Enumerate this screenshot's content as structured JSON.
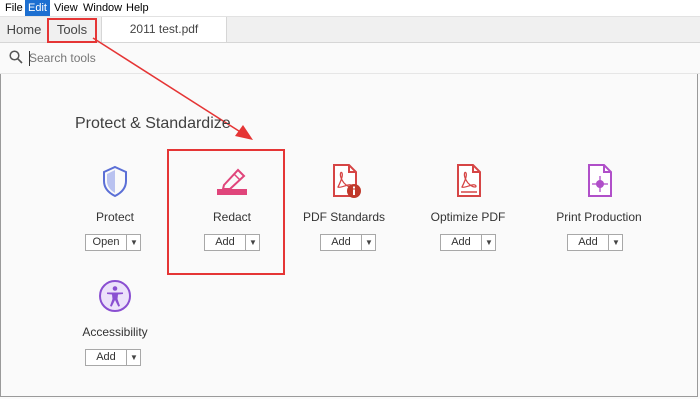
{
  "menu": [
    "File",
    "Edit",
    "View",
    "Window",
    "Help"
  ],
  "tabs": {
    "home": "Home",
    "tools": "Tools",
    "document": "2011 test.pdf"
  },
  "search": {
    "placeholder": "Search tools"
  },
  "section": {
    "title": "Protect & Standardize"
  },
  "tools": [
    {
      "label": "Protect",
      "button": "Open",
      "icon": "shield-icon"
    },
    {
      "label": "Redact",
      "button": "Add",
      "icon": "redact-marker-icon"
    },
    {
      "label": "PDF Standards",
      "button": "Add",
      "icon": "pdf-info-icon"
    },
    {
      "label": "Optimize PDF",
      "button": "Add",
      "icon": "pdf-optimize-icon"
    },
    {
      "label": "Print Production",
      "button": "Add",
      "icon": "print-production-icon"
    },
    {
      "label": "Accessibility",
      "button": "Add",
      "icon": "accessibility-icon"
    }
  ],
  "dropdown_glyph": "▼",
  "colors": {
    "annotation": "#e53535",
    "menu_active": "#1c6fd1",
    "protect": "#5b6fd6",
    "redact": "#e0457b",
    "pdf": "#d64545",
    "print": "#b04fc9",
    "accessibility": "#8a4fd1"
  }
}
